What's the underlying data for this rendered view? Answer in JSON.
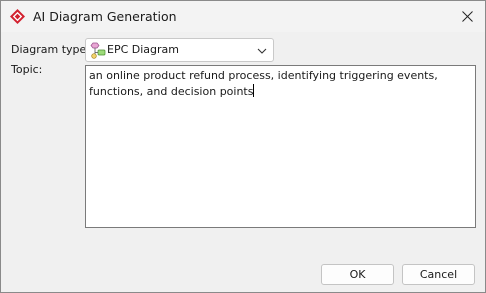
{
  "window": {
    "title": "AI Diagram Generation",
    "app_icon": "visual-paradigm-icon",
    "close_icon": "close-icon"
  },
  "form": {
    "diagram_type_label": "Diagram type:",
    "diagram_type_value": "EPC Diagram",
    "diagram_type_icon": "epc-diagram-icon",
    "topic_label": "Topic:",
    "topic_value": "an online product refund process, identifying triggering events, functions, and decision points"
  },
  "buttons": {
    "ok_label": "OK",
    "cancel_label": "Cancel"
  },
  "colors": {
    "dialog_background": "#f0f0f0",
    "app_icon_red": "#d2212f"
  }
}
